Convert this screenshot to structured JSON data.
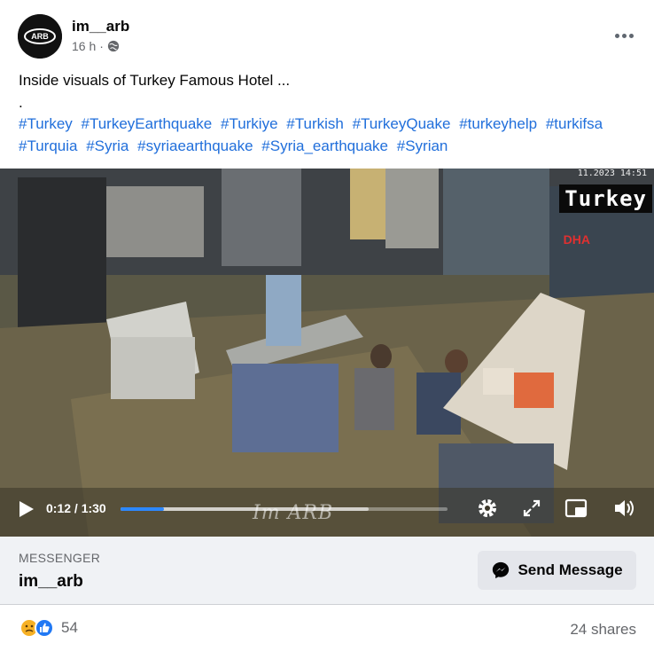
{
  "post": {
    "author": "im__arb",
    "time": "16 h",
    "separator": "·",
    "audience_icon": "globe-icon",
    "text_line1": "Inside visuals of Turkey Famous Hotel ...",
    "text_line2": ".",
    "hashtags": [
      "#Turkey",
      "#TurkeyEarthquake",
      "#Turkiye",
      "#Turkish",
      "#TurkeyQuake",
      "#turkeyhelp",
      "#turkifsa",
      "#Turquia",
      "#Syria",
      "#syriaearthquake",
      "#Syria_earthquake",
      "#Syrian"
    ]
  },
  "video": {
    "overlay_label": "Turkey",
    "timestamp": "11.2023 14:51",
    "channel_logo": "DHA",
    "watermark": "Im ARB",
    "current_time": "0:12",
    "duration": "1:30",
    "time_display": "0:12 / 1:30",
    "played_fraction": 0.133,
    "buffered_fraction": 0.76
  },
  "messenger": {
    "label": "MESSENGER",
    "name": "im__arb",
    "button_label": "Send Message"
  },
  "footer": {
    "reaction_count": "54",
    "shares": "24 shares"
  },
  "colors": {
    "link": "#216fdb",
    "progress": "#2d88ff",
    "muted": "#65676b",
    "messenger_bg": "#f0f2f5"
  }
}
